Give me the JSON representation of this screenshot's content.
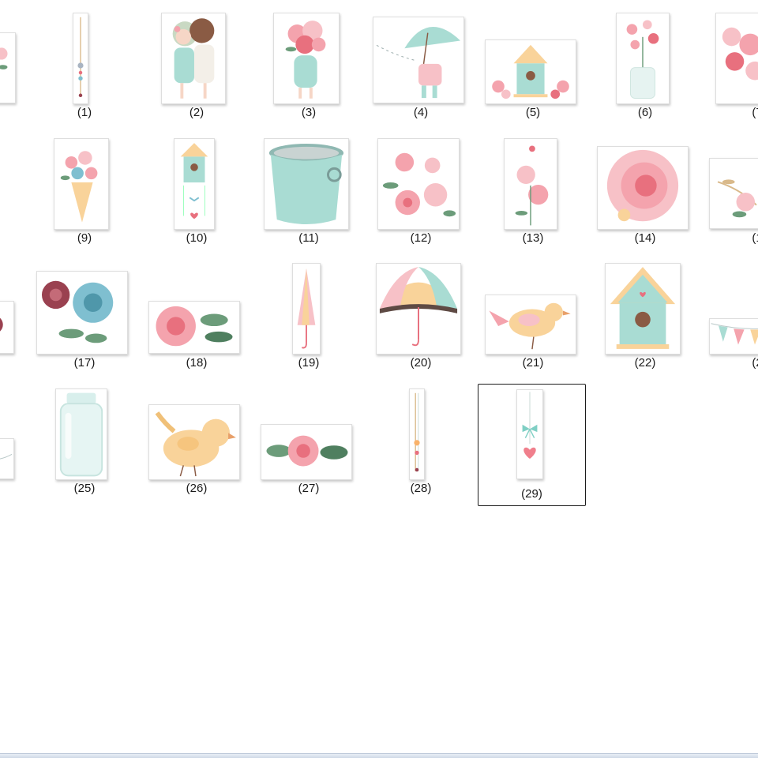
{
  "gallery": {
    "items": [
      {
        "label": "",
        "icon": "flowers-icon"
      },
      {
        "label": "(1)",
        "icon": "hanging-bead-string-icon"
      },
      {
        "label": "(2)",
        "icon": "two-girls-hugging-icon"
      },
      {
        "label": "(3)",
        "icon": "girl-with-flower-bouquet-icon"
      },
      {
        "label": "(4)",
        "icon": "girl-with-umbrella-icon"
      },
      {
        "label": "(5)",
        "icon": "birdhouse-with-flowers-icon"
      },
      {
        "label": "(6)",
        "icon": "mason-jar-flowers-icon"
      },
      {
        "label": "(7",
        "icon": "pink-flower-cluster-icon"
      },
      {
        "label": "(9)",
        "icon": "flower-ice-cream-cone-icon"
      },
      {
        "label": "(10)",
        "icon": "birdhouse-with-garland-icon"
      },
      {
        "label": "(11)",
        "icon": "metal-bucket-icon"
      },
      {
        "label": "(12)",
        "icon": "pink-roses-icon"
      },
      {
        "label": "(13)",
        "icon": "rose-stem-icon"
      },
      {
        "label": "(14)",
        "icon": "large-pink-rose-icon"
      },
      {
        "label": "(1",
        "icon": "floral-branch-icon"
      },
      {
        "label": "",
        "icon": "burgundy-rose-icon"
      },
      {
        "label": "(17)",
        "icon": "blue-and-burgundy-roses-icon"
      },
      {
        "label": "(18)",
        "icon": "pink-rose-with-leaves-icon"
      },
      {
        "label": "(19)",
        "icon": "closed-umbrella-icon"
      },
      {
        "label": "(20)",
        "icon": "open-umbrella-icon"
      },
      {
        "label": "(21)",
        "icon": "songbird-icon"
      },
      {
        "label": "(22)",
        "icon": "birdhouse-icon"
      },
      {
        "label": "(2",
        "icon": "bunting-banner-icon"
      },
      {
        "label": "",
        "icon": "banner-piece-icon"
      },
      {
        "label": "(25)",
        "icon": "glass-jar-icon"
      },
      {
        "label": "(26)",
        "icon": "yellow-chick-icon"
      },
      {
        "label": "(27)",
        "icon": "rose-with-leaves-icon"
      },
      {
        "label": "(28)",
        "icon": "hanging-ornament-icon"
      },
      {
        "label": "(29)",
        "icon": "heart-with-bow-icon"
      }
    ],
    "selected_label": "(29)"
  },
  "colors": {
    "selection_border": "#1b1b1b",
    "thumb_border": "#dedede",
    "mint": "#a9dcd3",
    "pink": "#f4a3ad",
    "rose": "#e8707e",
    "peach": "#f9d39a",
    "burgundy": "#9a4150",
    "blue": "#7fbfd0",
    "leaf": "#6c9c7a",
    "brown": "#8a5b44"
  }
}
